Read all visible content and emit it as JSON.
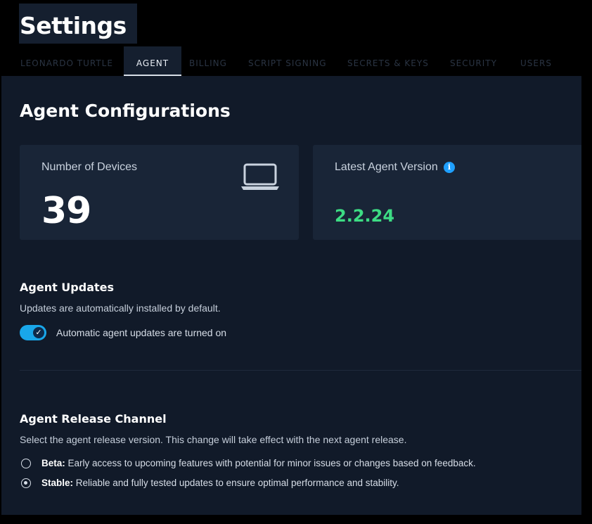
{
  "page": {
    "title": "Settings"
  },
  "tabs": [
    {
      "label": "LEONARDO TURTLE",
      "active": false
    },
    {
      "label": "AGENT",
      "active": true
    },
    {
      "label": "BILLING",
      "active": false
    },
    {
      "label": "SCRIPT SIGNING",
      "active": false
    },
    {
      "label": "SECRETS & KEYS",
      "active": false
    },
    {
      "label": "SECURITY",
      "active": false
    },
    {
      "label": "USERS",
      "active": false
    }
  ],
  "main": {
    "heading": "Agent Configurations",
    "devices_card": {
      "label": "Number of Devices",
      "value": "39",
      "icon": "laptop-icon"
    },
    "version_card": {
      "label": "Latest Agent Version",
      "value": "2.2.24",
      "value_color": "#3ddc84",
      "icon": "info-icon",
      "info_glyph": "i"
    },
    "updates": {
      "title": "Agent Updates",
      "description": "Updates are automatically installed by default.",
      "toggle_on": true,
      "toggle_label": "Automatic agent updates are turned on",
      "toggle_check": "✓",
      "accent": "#19a7ea"
    },
    "release_channel": {
      "title": "Agent Release Channel",
      "description": "Select the agent release version. This change will take effect with the next agent release.",
      "options": [
        {
          "name": "Beta:",
          "text": "Early access to upcoming features with potential for minor issues or changes based on feedback.",
          "selected": false
        },
        {
          "name": "Stable:",
          "text": "Reliable and fully tested updates to ensure optimal performance and stability.",
          "selected": true
        }
      ]
    }
  }
}
